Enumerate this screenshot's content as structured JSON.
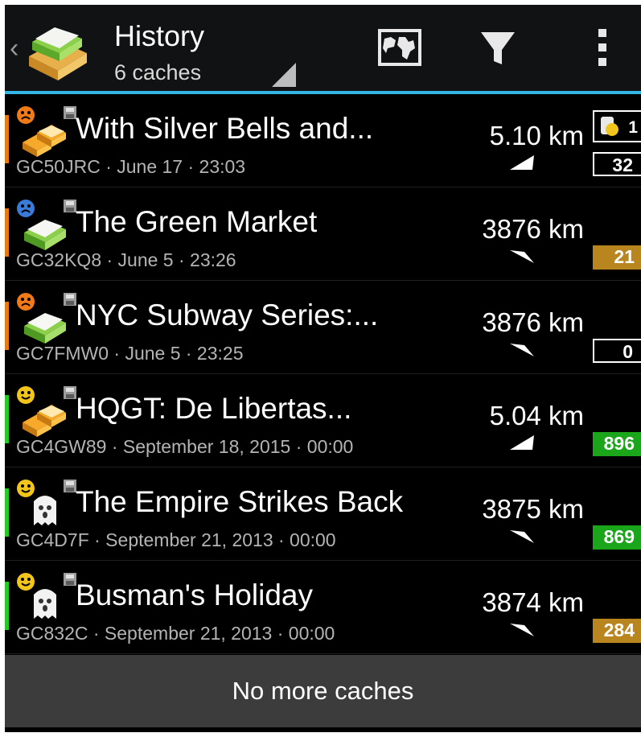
{
  "actionbar": {
    "title": "History",
    "subtitle": "6 caches",
    "icons": [
      "app-logo-icon",
      "map-icon",
      "filter-icon",
      "overflow-menu-icon"
    ]
  },
  "caches": [
    {
      "name": "With Silver Bells and...",
      "code": "GC50JRC",
      "info": "GC50JRC · June 17 · 23:03",
      "distance": "5.10 km",
      "type": "multi",
      "mood": "sad",
      "stripe_color": "#e67a10",
      "trackables": "1",
      "favorites": "32",
      "fav_style": "outline"
    },
    {
      "name": "The Green Market",
      "code": "GC32KQ8",
      "info": "GC32KQ8 · June 5 · 23:26",
      "distance": "3876 km",
      "type": "traditional",
      "mood": "blue-sad",
      "stripe_color": "#e67a10",
      "favorites": "21",
      "fav_style": "brown"
    },
    {
      "name": "NYC Subway Series:...",
      "code": "GC7FMW0",
      "info": "GC7FMW0 · June 5 · 23:25",
      "distance": "3876 km",
      "type": "traditional",
      "mood": "sad",
      "stripe_color": "#e67a10",
      "favorites": "0",
      "fav_style": "outline"
    },
    {
      "name": "HQGT: De Libertas...",
      "code": "GC4GW89",
      "info": "GC4GW89 · September 18, 2015 · 00:00",
      "distance": "5.04 km",
      "type": "multi",
      "mood": "happy",
      "stripe_color": "#22cc22",
      "favorites": "896",
      "fav_style": "green"
    },
    {
      "name": "The Empire Strikes Back",
      "code": "GC4D7F",
      "info": "GC4D7F · September 21, 2013 · 00:00",
      "distance": "3875 km",
      "type": "virtual",
      "mood": "happy",
      "stripe_color": "#22cc22",
      "favorites": "869",
      "fav_style": "green"
    },
    {
      "name": "Busman's Holiday",
      "code": "GC832C",
      "info": "GC832C · September 21, 2013 · 00:00",
      "distance": "3874 km",
      "type": "virtual",
      "mood": "happy",
      "stripe_color": "#22cc22",
      "favorites": "284",
      "fav_style": "brown"
    }
  ],
  "footer": {
    "label": "No more caches"
  }
}
